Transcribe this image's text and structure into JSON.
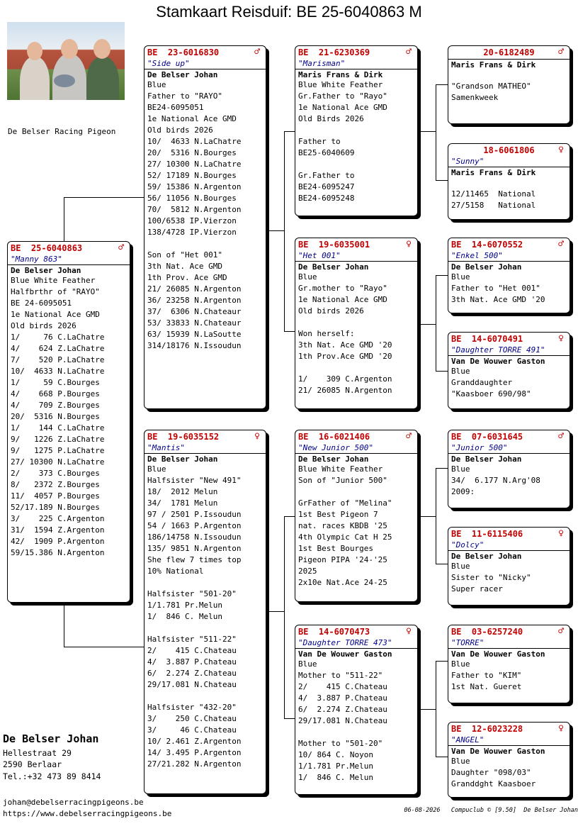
{
  "title": "Stamkaart Reisduif: BE  25-6040863 M",
  "club_name": "De Belser Racing Pigeon",
  "owner": {
    "name": "De Belser Johan",
    "street": "Hellestraat 29",
    "city": "2590  Berlaar",
    "tel": "Tel.:+32 473 89 8414",
    "email": "johan@debelserracingpigeons.be",
    "website": "https://www.debelserracingpigeons.be"
  },
  "footer": "06-08-2026   Compuclub © [9.50]  De Belser Johan",
  "pigeons": {
    "subject": {
      "ring": "BE  25-6040863",
      "sex": "♂",
      "nick": "\"Manny 863\"",
      "breeder": "De Belser Johan",
      "lines": [
        "Blue White Feather",
        "Halfbrthr of \"RAYO\"",
        "BE 24-6095051",
        "1e National Ace GMD",
        "Old birds 2026",
        "1/     76 C.LaChatre",
        "4/    624 Z.LaChatre",
        "7/    520 P.LaChatre",
        "10/  4633 N.LaChatre",
        "1/     59 C.Bourges",
        "4/    668 P.Bourges",
        "4/    709 Z.Bourges",
        "20/  5316 N.Bourges",
        "1/    144 C.LaChatre",
        "9/   1226 Z.LaChatre",
        "9/   1275 P.LaChatre",
        "27/ 10300 N.LaChatre",
        "2/    373 C.Bourges",
        "8/   2372 Z.Bourges",
        "11/  4057 P.Bourges",
        "52/17.189 N.Bourges",
        "3/    225 C.Argenton",
        "31/  1594 Z.Argenton",
        "42/  1909 P.Argenton",
        "59/15.386 N.Argenton"
      ]
    },
    "father": {
      "ring": "BE  23-6016830",
      "sex": "♂",
      "nick": "\"Side up\"",
      "breeder": "De Belser Johan",
      "lines": [
        "Blue",
        "Father to \"RAYO\"",
        "BE24-6095051",
        "1e National Ace GMD",
        "Old birds 2026",
        "10/  4633 N.LaChatre",
        "20/  5316 N.Bourges",
        "27/ 10300 N.LaChatre",
        "52/ 17189 N.Bourges",
        "59/ 15386 N.Argenton",
        "56/ 11056 N.Bourges",
        "70/  5812 N.Argenton",
        "100/6538 IP.Vierzon",
        "138/4728 IP.Vierzon",
        "",
        "Son of \"Het 001\"",
        "3th Nat. Ace GMD",
        "1th Prov. Ace GMD",
        "21/ 26085 N.Argenton",
        "36/ 23258 N.Argenton",
        "37/  6306 N.Chateaur",
        "53/ 33833 N.Chateaur",
        "63/ 15939 N.LaSoutte",
        "314/18176 N.Issoudun"
      ]
    },
    "mother": {
      "ring": "BE  19-6035152",
      "sex": "♀",
      "nick": "\"Mantis\"",
      "breeder": "De Belser Johan",
      "lines": [
        "Blue",
        "Halfsister \"New 491\"",
        "18/  2012 Melun",
        "34/  1781 Melun",
        "97 / 2501 P.Issoudun",
        "54 / 1663 P.Argenton",
        "186/14758 N.Issoudun",
        "135/ 9851 N.Argenton",
        "She flew 7 times top",
        "10% National",
        "",
        "Halfsister \"501-20\"",
        "1/1.781 Pr.Melun",
        "1/  846 C. Melun",
        "",
        "Halfsister \"511-22\"",
        "2/    415 C.Chateau",
        "4/  3.887 P.Chateau",
        "6/  2.274 Z.Chateau",
        "29/17.081 N.Chateau",
        "",
        "Halfsister \"432-20\"",
        "3/    250 C.Chateau",
        "3/     46 C.Chateau",
        "10/ 2.461 Z.Argenton",
        "14/ 3.495 P.Argenton",
        "27/21.282 N.Argenton"
      ]
    },
    "ff": {
      "ring": "BE  21-6230369",
      "sex": "♂",
      "nick": "\"Marisman\"",
      "breeder": "Maris Frans & Dirk",
      "lines": [
        "Blue White Feather",
        "Gr.Father to \"Rayo\"",
        "1e National Ace GMD",
        "Old Birds 2026",
        "",
        "Father to",
        "BE25-6040609",
        "",
        "Gr.Father to",
        "BE24-6095247",
        "BE24-6095248"
      ]
    },
    "fm": {
      "ring": "BE  19-6035001",
      "sex": "♀",
      "nick": "\"Het 001\"",
      "breeder": "De Belser Johan",
      "lines": [
        "Blue",
        "Gr.mother to \"Rayo\"",
        "1e National Ace GMD",
        "Old birds 2026",
        "",
        "Won herself:",
        "3th Nat. Ace GMD '20",
        "1th Prov.Ace GMD '20",
        "",
        "1/    309 C.Argenton",
        "21/ 26085 N.Argenton"
      ]
    },
    "mf": {
      "ring": "BE  16-6021406",
      "sex": "♂",
      "nick": "\"New Junior 500\"",
      "breeder": "De Belser Johan",
      "lines": [
        "Blue White Feather",
        "Son of \"Junior 500\"",
        "",
        "GrFather of \"Melina\"",
        "1st Best Pigeon 7",
        "nat. races KBDB '25",
        "4th Olympic Cat H 25",
        "1st Best Bourges",
        "Pigeon PIPA '24-'25",
        "2025",
        "2x10e Nat.Ace 24-25"
      ]
    },
    "mm": {
      "ring": "BE  14-6070473",
      "sex": "♀",
      "nick": "\"Daughter TORRE 473\"",
      "breeder": "Van De Wouwer Gaston",
      "lines": [
        "Blue",
        "Mother to \"511-22\"",
        "2/    415 C.Chateau",
        "4/  3.887 P.Chateau",
        "6/  2.274 Z.Chateau",
        "29/17.081 N.Chateau",
        "",
        "Mother to \"501-20\"",
        "10/ 864 C. Noyon",
        "1/1.781 Pr.Melun",
        "1/  846 C. Melun"
      ]
    },
    "fff": {
      "ring": "20-6182489",
      "sex": "♂",
      "nick": "",
      "breeder": "Maris Frans & Dirk",
      "lines": [
        "",
        "\"Grandson MATHEO\"",
        "Samenkweek"
      ]
    },
    "ffm": {
      "ring": "18-6061806",
      "sex": "♀",
      "nick": "\"Sunny\"",
      "breeder": "Maris Frans & Dirk",
      "lines": [
        "",
        "12/11465  National",
        "27/5158   National"
      ]
    },
    "fmf": {
      "ring": "BE  14-6070552",
      "sex": "♂",
      "nick": "\"Enkel 500\"",
      "breeder": "De Belser Johan",
      "lines": [
        "Blue",
        "Father to \"Het 001\"",
        "3th Nat. Ace GMD '20"
      ]
    },
    "fmm": {
      "ring": "BE  14-6070491",
      "sex": "♀",
      "nick": "\"Daughter TORRE 491\"",
      "breeder": "Van De Wouwer Gaston",
      "lines": [
        "Blue",
        "Granddaughter",
        "\"Kaasboer 690/98\""
      ]
    },
    "mff": {
      "ring": "BE  07-6031645",
      "sex": "♂",
      "nick": "\"Junior 500\"",
      "breeder": "De Belser Johan",
      "lines": [
        "Blue",
        "34/  6.177 N.Arg'08",
        "2009:"
      ]
    },
    "mfm": {
      "ring": "BE  11-6115406",
      "sex": "♀",
      "nick": "\"Dolcy\"",
      "breeder": "De Belser Johan",
      "lines": [
        "Blue",
        "Sister to \"Nicky\"",
        "Super racer"
      ]
    },
    "mmf": {
      "ring": "BE  03-6257240",
      "sex": "♂",
      "nick": "\"TORRE\"",
      "breeder": "Van De Wouwer Gaston",
      "lines": [
        "Blue",
        "Father to \"KIM\"",
        "1st Nat. Gueret"
      ]
    },
    "mmm": {
      "ring": "BE  12-6023228",
      "sex": "♀",
      "nick": "\"ANGEL\"",
      "breeder": "Van De Wouwer Gaston",
      "lines": [
        "Blue",
        "Daughter \"098/03\"",
        "Granddght Kaasboer"
      ]
    }
  }
}
